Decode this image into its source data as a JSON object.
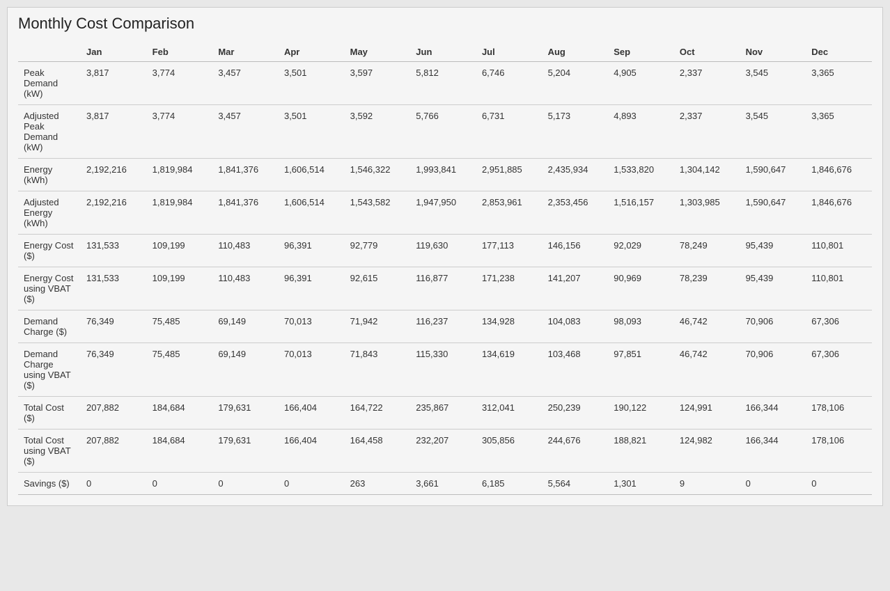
{
  "title": "Monthly Cost Comparison",
  "columns": [
    "",
    "Jan",
    "Feb",
    "Mar",
    "Apr",
    "May",
    "Jun",
    "Jul",
    "Aug",
    "Sep",
    "Oct",
    "Nov",
    "Dec"
  ],
  "rows": [
    {
      "label": "Peak Demand (kW)",
      "values": [
        "3,817",
        "3,774",
        "3,457",
        "3,501",
        "3,597",
        "5,812",
        "6,746",
        "5,204",
        "4,905",
        "2,337",
        "3,545",
        "3,365"
      ]
    },
    {
      "label": "Adjusted Peak Demand (kW)",
      "values": [
        "3,817",
        "3,774",
        "3,457",
        "3,501",
        "3,592",
        "5,766",
        "6,731",
        "5,173",
        "4,893",
        "2,337",
        "3,545",
        "3,365"
      ]
    },
    {
      "label": "Energy (kWh)",
      "values": [
        "2,192,216",
        "1,819,984",
        "1,841,376",
        "1,606,514",
        "1,546,322",
        "1,993,841",
        "2,951,885",
        "2,435,934",
        "1,533,820",
        "1,304,142",
        "1,590,647",
        "1,846,676"
      ]
    },
    {
      "label": "Adjusted Energy (kWh)",
      "values": [
        "2,192,216",
        "1,819,984",
        "1,841,376",
        "1,606,514",
        "1,543,582",
        "1,947,950",
        "2,853,961",
        "2,353,456",
        "1,516,157",
        "1,303,985",
        "1,590,647",
        "1,846,676"
      ]
    },
    {
      "label": "Energy Cost ($)",
      "values": [
        "131,533",
        "109,199",
        "110,483",
        "96,391",
        "92,779",
        "119,630",
        "177,113",
        "146,156",
        "92,029",
        "78,249",
        "95,439",
        "110,801"
      ]
    },
    {
      "label": "Energy Cost using VBAT ($)",
      "values": [
        "131,533",
        "109,199",
        "110,483",
        "96,391",
        "92,615",
        "116,877",
        "171,238",
        "141,207",
        "90,969",
        "78,239",
        "95,439",
        "110,801"
      ]
    },
    {
      "label": "Demand Charge ($)",
      "values": [
        "76,349",
        "75,485",
        "69,149",
        "70,013",
        "71,942",
        "116,237",
        "134,928",
        "104,083",
        "98,093",
        "46,742",
        "70,906",
        "67,306"
      ]
    },
    {
      "label": "Demand Charge using VBAT ($)",
      "values": [
        "76,349",
        "75,485",
        "69,149",
        "70,013",
        "71,843",
        "115,330",
        "134,619",
        "103,468",
        "97,851",
        "46,742",
        "70,906",
        "67,306"
      ]
    },
    {
      "label": "Total Cost ($)",
      "values": [
        "207,882",
        "184,684",
        "179,631",
        "166,404",
        "164,722",
        "235,867",
        "312,041",
        "250,239",
        "190,122",
        "124,991",
        "166,344",
        "178,106"
      ]
    },
    {
      "label": "Total Cost using VBAT ($)",
      "values": [
        "207,882",
        "184,684",
        "179,631",
        "166,404",
        "164,458",
        "232,207",
        "305,856",
        "244,676",
        "188,821",
        "124,982",
        "166,344",
        "178,106"
      ]
    },
    {
      "label": "Savings ($)",
      "values": [
        "0",
        "0",
        "0",
        "0",
        "263",
        "3,661",
        "6,185",
        "5,564",
        "1,301",
        "9",
        "0",
        "0"
      ]
    }
  ]
}
